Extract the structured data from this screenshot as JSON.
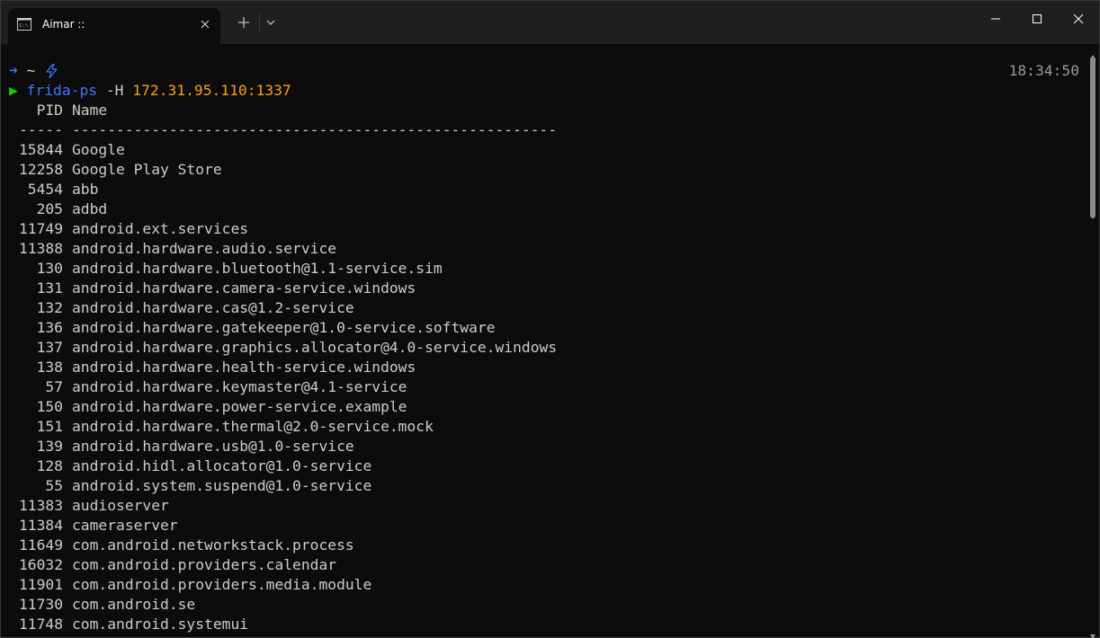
{
  "window": {
    "tab_title": "Aimar ::",
    "tab_icon": "terminal-icon",
    "close_tab_icon": "close-icon",
    "new_tab_icon": "plus-icon",
    "dropdown_icon": "chevron-down-icon",
    "controls": [
      "minimize-icon",
      "maximize-icon",
      "close-icon"
    ]
  },
  "terminal": {
    "clock": "18:34:50",
    "prompt_line": {
      "arrow": "➜",
      "path": "~",
      "bolt_icon": "lightning-icon"
    },
    "command_line": {
      "prompt": "▶",
      "command": "frida-ps",
      "flag": "-H",
      "argument": "172.31.95.110:1337"
    },
    "header": {
      "pid": "PID",
      "name": "Name"
    },
    "separator": {
      "pid": "-----",
      "name": "-------------------------------------------------------"
    },
    "processes": [
      {
        "pid": "15844",
        "name": "Google"
      },
      {
        "pid": "12258",
        "name": "Google Play Store"
      },
      {
        "pid": "5454",
        "name": "abb"
      },
      {
        "pid": "205",
        "name": "adbd"
      },
      {
        "pid": "11749",
        "name": "android.ext.services"
      },
      {
        "pid": "11388",
        "name": "android.hardware.audio.service"
      },
      {
        "pid": "130",
        "name": "android.hardware.bluetooth@1.1-service.sim"
      },
      {
        "pid": "131",
        "name": "android.hardware.camera-service.windows"
      },
      {
        "pid": "132",
        "name": "android.hardware.cas@1.2-service"
      },
      {
        "pid": "136",
        "name": "android.hardware.gatekeeper@1.0-service.software"
      },
      {
        "pid": "137",
        "name": "android.hardware.graphics.allocator@4.0-service.windows"
      },
      {
        "pid": "138",
        "name": "android.hardware.health-service.windows"
      },
      {
        "pid": "57",
        "name": "android.hardware.keymaster@4.1-service"
      },
      {
        "pid": "150",
        "name": "android.hardware.power-service.example"
      },
      {
        "pid": "151",
        "name": "android.hardware.thermal@2.0-service.mock"
      },
      {
        "pid": "139",
        "name": "android.hardware.usb@1.0-service"
      },
      {
        "pid": "128",
        "name": "android.hidl.allocator@1.0-service"
      },
      {
        "pid": "55",
        "name": "android.system.suspend@1.0-service"
      },
      {
        "pid": "11383",
        "name": "audioserver"
      },
      {
        "pid": "11384",
        "name": "cameraserver"
      },
      {
        "pid": "11649",
        "name": "com.android.networkstack.process"
      },
      {
        "pid": "16032",
        "name": "com.android.providers.calendar"
      },
      {
        "pid": "11901",
        "name": "com.android.providers.media.module"
      },
      {
        "pid": "11730",
        "name": "com.android.se"
      },
      {
        "pid": "11748",
        "name": "com.android.systemui"
      }
    ]
  },
  "colors": {
    "background": "#0c0c0c",
    "titlebar": "#1f1f1f",
    "text": "#cccccc",
    "blue": "#3b78ff",
    "green": "#16c60c",
    "orange": "#f9a01b"
  }
}
